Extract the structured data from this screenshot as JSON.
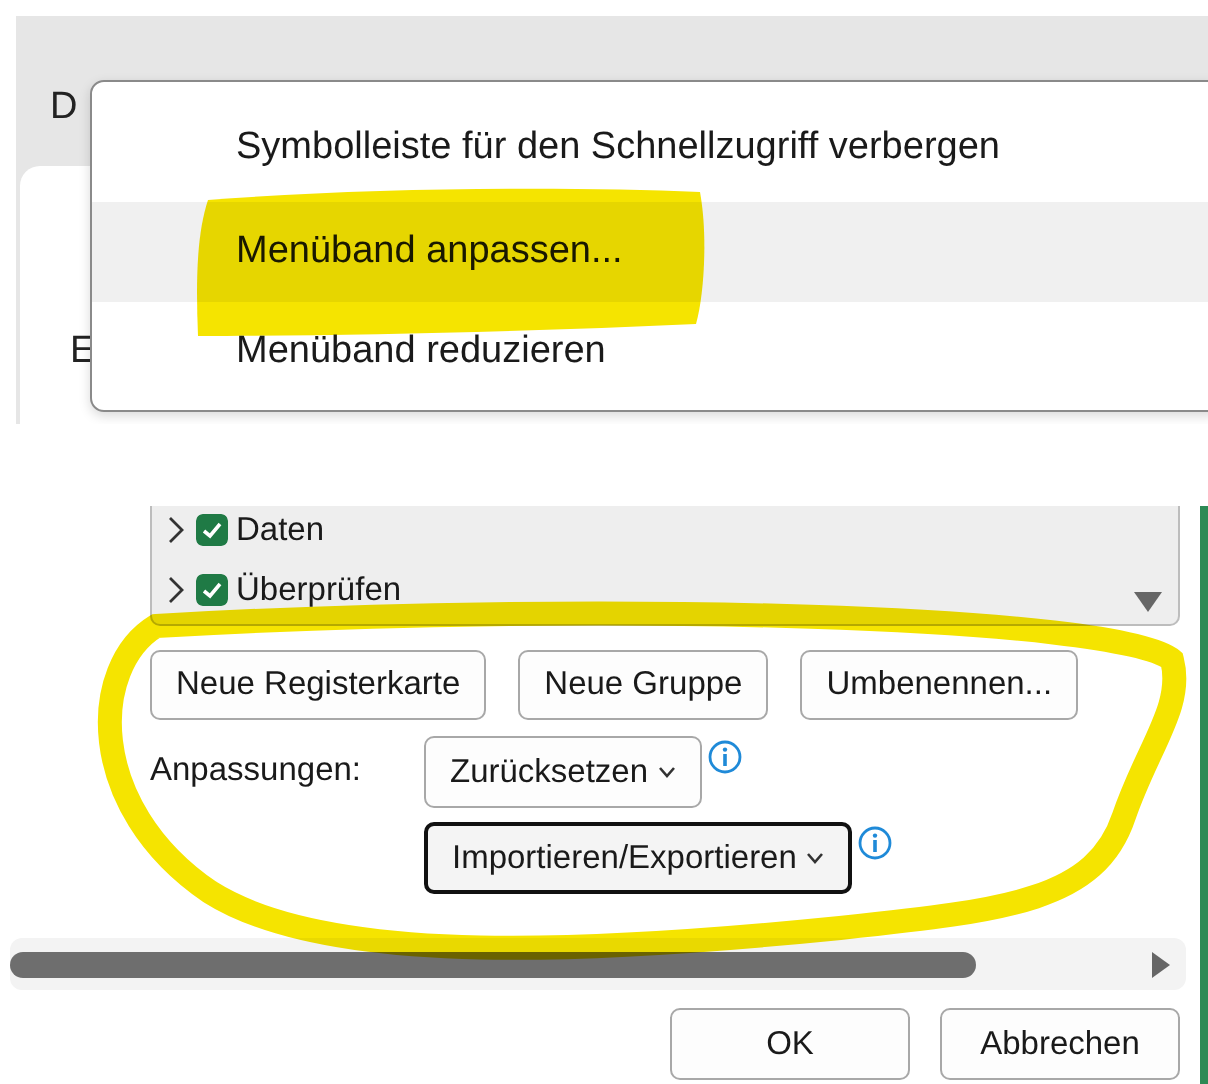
{
  "hidden_text": [
    "D",
    "E"
  ],
  "context_menu": {
    "items": [
      {
        "label": "Symbolleiste für den Schnellzugriff verbergen",
        "selected": false
      },
      {
        "label": "Menüband anpassen...",
        "selected": true
      },
      {
        "label": "Menüband reduzieren",
        "selected": false
      }
    ]
  },
  "tab_list": {
    "items": [
      {
        "label": "Daten",
        "checked": true,
        "expanded": false
      },
      {
        "label": "Überprüfen",
        "checked": true,
        "expanded": false
      }
    ]
  },
  "tab_buttons": [
    "Neue Registerkarte",
    "Neue Gruppe",
    "Umbenennen..."
  ],
  "customizations": {
    "label": "Anpassungen:",
    "buttons": [
      {
        "label": "Zurücksetzen",
        "focused": false
      },
      {
        "label": "Importieren/Exportieren",
        "focused": true
      }
    ]
  },
  "dialog_buttons": [
    "OK",
    "Abbrechen"
  ],
  "annotations": [
    {
      "kind": "highlight"
    },
    {
      "kind": "loop"
    }
  ]
}
